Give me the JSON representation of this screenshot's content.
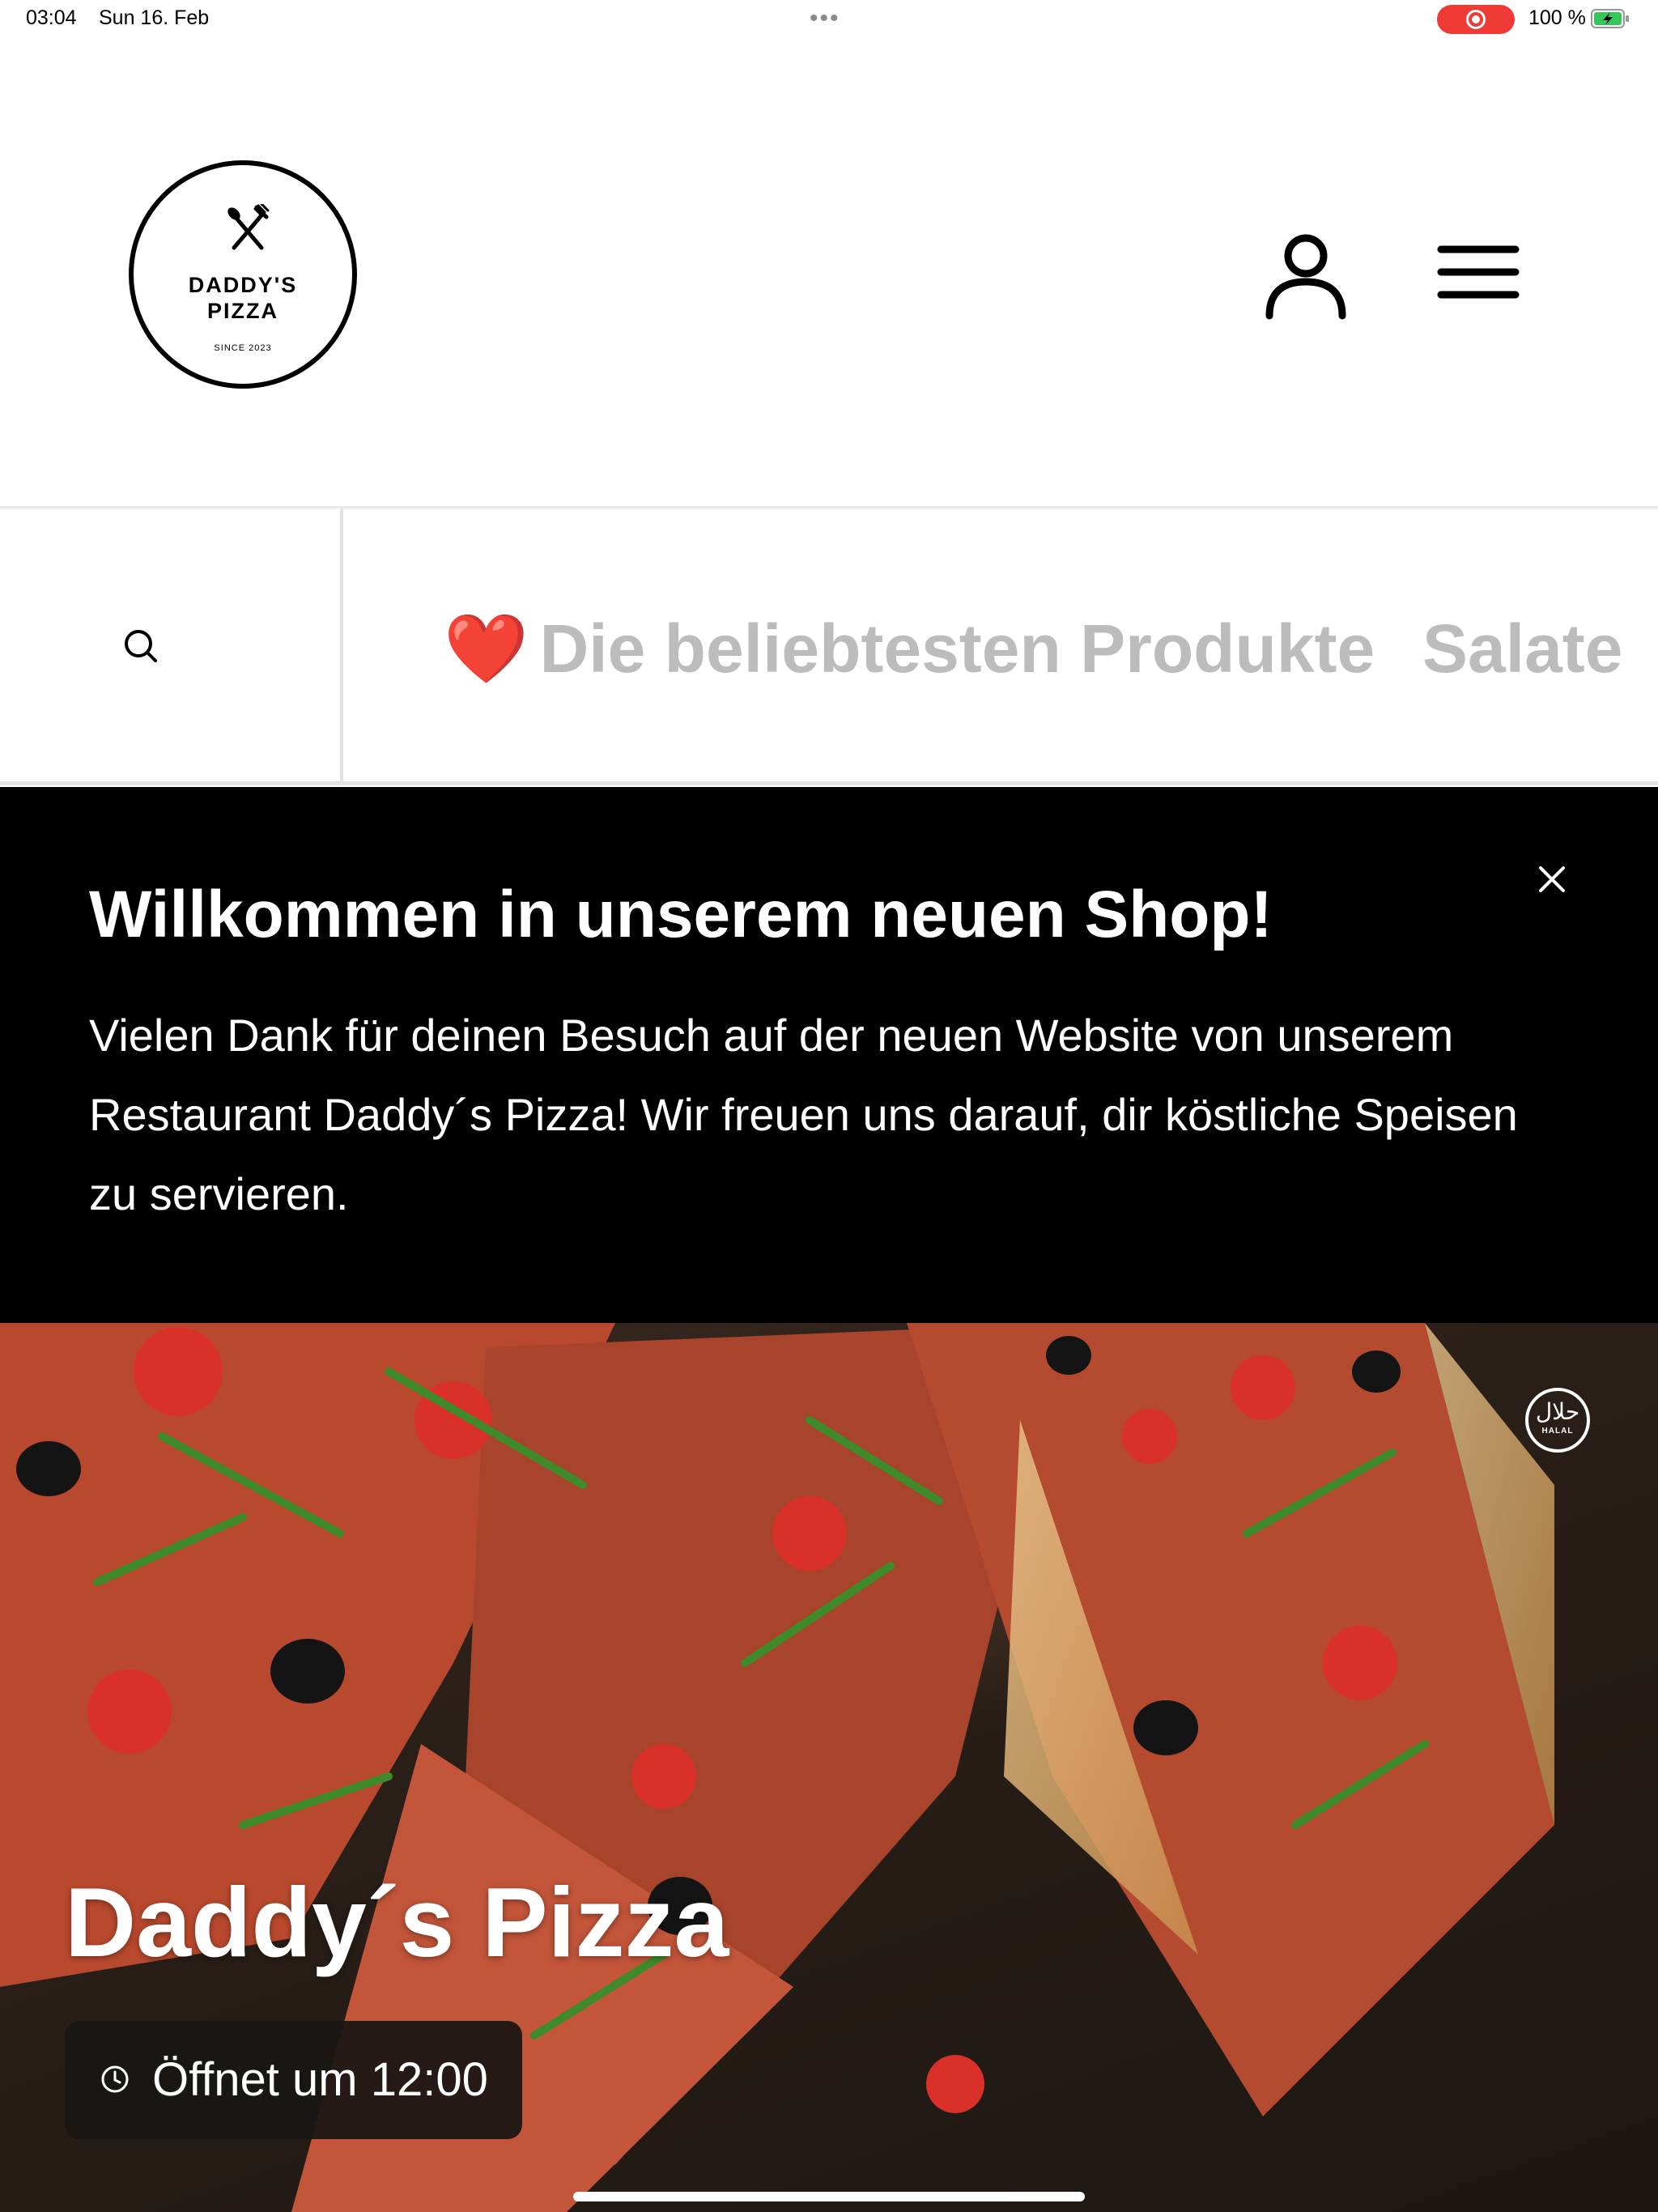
{
  "status_bar": {
    "time": "03:04",
    "date": "Sun 16. Feb",
    "dots": "•••",
    "battery": "100 %"
  },
  "logo": {
    "line1": "DADDY'S",
    "line2": "PIZZA",
    "since": "SINCE 2023"
  },
  "nav": {
    "categories": [
      {
        "emoji": "❤️",
        "label": "Die beliebtesten Produkte"
      },
      {
        "label": "Salate"
      }
    ]
  },
  "banner": {
    "title": "Willkommen in unserem neuen Shop!",
    "text": "Vielen Dank für deinen Besuch auf der neuen Website von unserem Restaurant Daddy´s Pizza! Wir freuen uns darauf, dir köstliche Speisen zu servieren."
  },
  "hero": {
    "title": "Daddy´s Pizza",
    "hours": "Öffnet um 12:00",
    "halal_ar": "حلال",
    "halal_lat": "HALAL"
  },
  "colors": {
    "accent_red": "#ef3a36",
    "category_text": "#bcbcbc",
    "banner_bg": "#000000"
  },
  "icons": [
    "search-icon",
    "user-icon",
    "menu-icon",
    "close-icon",
    "clock-icon",
    "cutlery-icon",
    "halal-badge"
  ]
}
